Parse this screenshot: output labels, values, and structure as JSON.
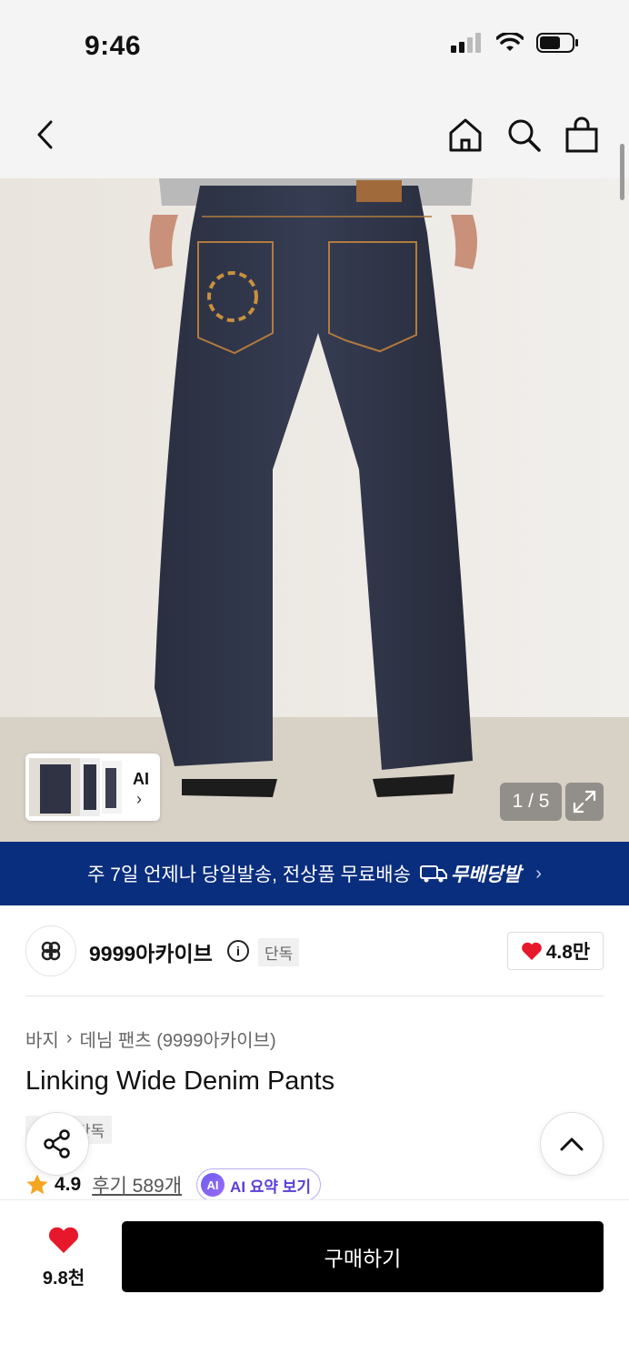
{
  "status_bar": {
    "time": "9:46"
  },
  "image": {
    "counter": "1 / 5",
    "ai_label": "AI"
  },
  "banner": {
    "text": "주 7일 언제나 당일발송, 전상품 무료배송",
    "brand": "무배당발"
  },
  "brand": {
    "name": "9999아카이브",
    "badge": "단독",
    "likes": "4.8만"
  },
  "breadcrumb": {
    "category": "바지",
    "subcategory": "데님 팬츠 (9999아카이브)"
  },
  "product": {
    "title": "Linking Wide Denim Pants",
    "tag": "단독"
  },
  "rating": {
    "score": "4.9",
    "reviews": "후기 589개",
    "ai_summary": "AI 요약 보기",
    "ai_badge": "AI"
  },
  "bottom": {
    "heart_count": "9.8천",
    "buy_label": "구매하기"
  },
  "colors": {
    "banner_bg": "#0a2e7e",
    "heart": "#e8182c",
    "star": "#f5a623",
    "ai_purple": "#5a3fd6"
  },
  "icons": [
    "back-icon",
    "home-icon",
    "search-icon",
    "bag-icon",
    "expand-icon",
    "info-icon",
    "heart-icon",
    "star-icon",
    "share-icon",
    "chevron-up-icon"
  ]
}
